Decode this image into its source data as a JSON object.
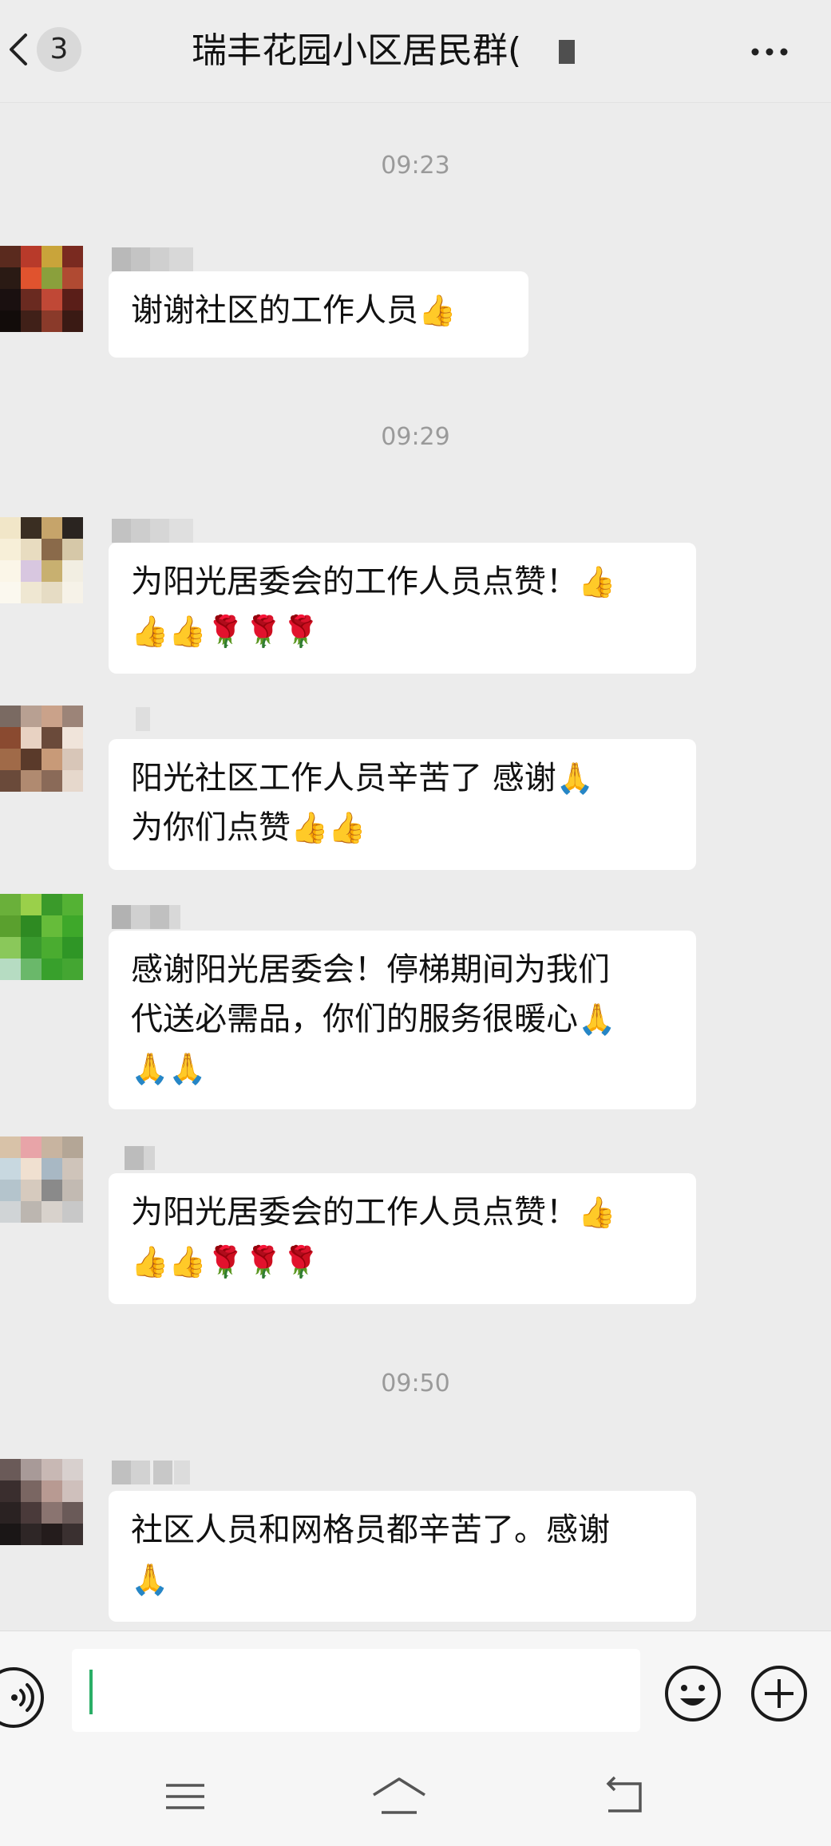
{
  "header": {
    "back_icon": "chevron-left-icon",
    "unread_count": "3",
    "title": "瑞丰花园小区居民群(",
    "more_icon": "more-horizontal-icon"
  },
  "messages": {
    "ts1": "09:23",
    "m1": {
      "text": "谢谢社区的工作人员",
      "emoji": "👍"
    },
    "ts2": "09:29",
    "m2": {
      "line1": "为阳光居委会的工作人员点赞！",
      "line1_emoji": "👍",
      "line2_emoji": "👍👍🌹🌹🌹"
    },
    "m3": {
      "line1": "阳光社区工作人员辛苦了 感谢",
      "line1_emoji": "🙏",
      "line2": "为你们点赞",
      "line2_emoji": "👍👍"
    },
    "m4": {
      "line1": "感谢阳光居委会！停梯期间为我们",
      "line2": "代送必需品，你们的服务很暖心",
      "line2_emoji": "🙏",
      "line3_emoji": "🙏🙏"
    },
    "m5": {
      "line1": "为阳光居委会的工作人员点赞！",
      "line1_emoji": "👍",
      "line2_emoji": "👍👍🌹🌹🌹"
    },
    "ts3": "09:50",
    "m6": {
      "line1": "社区人员和网格员都辛苦了。感谢",
      "line2_emoji": "🙏"
    }
  },
  "input": {
    "voice_icon": "voice-icon",
    "value": "",
    "emoji_icon": "smiley-icon",
    "plus_icon": "plus-circle-icon"
  },
  "navbar": {
    "menu_icon": "menu-icon",
    "home_icon": "home-icon",
    "back_icon": "back-icon"
  },
  "colors": {
    "background": "#ececec",
    "bubble": "#ffffff",
    "timestamp": "#9a9a9a",
    "caret": "#2aae67"
  }
}
